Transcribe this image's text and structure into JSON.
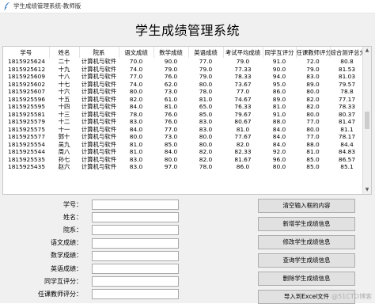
{
  "window": {
    "title": "学生成绩管理系统-教师版"
  },
  "heading": "学生成绩管理系统",
  "table": {
    "columns": [
      "学号",
      "姓名",
      "院系",
      "语文成绩",
      "数学成绩",
      "英语成绩",
      "考试平均成绩",
      "同学互评分",
      "任课教师评分",
      "综合测评总分"
    ],
    "rows": [
      [
        "1815925624",
        "二十",
        "计算机与软件",
        "70.0",
        "90.0",
        "77.0",
        "79.0",
        "91.0",
        "72.0",
        "80.8"
      ],
      [
        "1815925612",
        "十九",
        "计算机与软件",
        "74.0",
        "79.0",
        "79.0",
        "77.33",
        "90.0",
        "79.0",
        "81.53"
      ],
      [
        "1815925609",
        "十八",
        "计算机与软件",
        "77.0",
        "76.0",
        "79.0",
        "78.33",
        "94.0",
        "83.0",
        "81.03"
      ],
      [
        "1815925602",
        "十七",
        "计算机与软件",
        "74.0",
        "62.0",
        "80.0",
        "73.67",
        "95.0",
        "89.0",
        "79.57"
      ],
      [
        "1815925607",
        "十六",
        "计算机与软件",
        "80.0",
        "73.0",
        "78.0",
        "77.0",
        "86.0",
        "80.0",
        "78.8"
      ],
      [
        "1815925596",
        "十五",
        "计算机与软件",
        "82.0",
        "61.0",
        "81.0",
        "74.67",
        "89.0",
        "82.0",
        "77.17"
      ],
      [
        "1815925595",
        "十四",
        "计算机与软件",
        "84.0",
        "81.0",
        "65.0",
        "76.33",
        "81.0",
        "82.0",
        "78.33"
      ],
      [
        "1815925581",
        "十三",
        "计算机与软件",
        "78.0",
        "76.0",
        "85.0",
        "79.67",
        "91.0",
        "80.0",
        "80.37"
      ],
      [
        "1815925579",
        "十二",
        "计算机与软件",
        "83.0",
        "76.0",
        "83.0",
        "80.67",
        "88.0",
        "77.0",
        "81.47"
      ],
      [
        "1815925575",
        "十一",
        "计算机与软件",
        "84.0",
        "77.0",
        "83.0",
        "81.0",
        "84.0",
        "80.0",
        "81.1"
      ],
      [
        "1815925577",
        "郭十",
        "计算机与软件",
        "80.0",
        "73.0",
        "80.0",
        "77.67",
        "84.0",
        "77.0",
        "78.17"
      ],
      [
        "1815925554",
        "吴九",
        "计算机与软件",
        "81.0",
        "85.0",
        "80.0",
        "82.0",
        "84.0",
        "88.0",
        "84.4"
      ],
      [
        "1815925544",
        "周八",
        "计算机与软件",
        "81.0",
        "84.0",
        "82.0",
        "82.33",
        "92.0",
        "81.0",
        "84.83"
      ],
      [
        "1815925535",
        "孙七",
        "计算机与软件",
        "83.0",
        "80.0",
        "82.0",
        "81.67",
        "96.0",
        "85.0",
        "86.57"
      ],
      [
        "1815925435",
        "赵六",
        "计算机与软件",
        "83.0",
        "97.0",
        "78.0",
        "86.0",
        "80.0",
        "85.0",
        "85.1"
      ]
    ]
  },
  "form": {
    "fields": [
      {
        "label": "学号：",
        "value": ""
      },
      {
        "label": "姓名：",
        "value": ""
      },
      {
        "label": "院系：",
        "value": ""
      },
      {
        "label": "语文成绩：",
        "value": ""
      },
      {
        "label": "数学成绩：",
        "value": ""
      },
      {
        "label": "英语成绩：",
        "value": ""
      },
      {
        "label": "同学互评分：",
        "value": ""
      },
      {
        "label": "任课教师评分：",
        "value": ""
      }
    ]
  },
  "buttons": {
    "clear": "清空输入框的内容",
    "add": "新增学生成绩信息",
    "edit": "修改学生成绩信息",
    "query": "查询学生成绩信息",
    "delete": "删除学生成绩信息",
    "import": "导入到Excel文件"
  },
  "watermark": "@51CTO博客",
  "icons": {
    "app": "feather-icon",
    "scroll_up": "chevron-up-icon",
    "scroll_down": "chevron-down-icon"
  },
  "colors": {
    "window_bg": "#f0f0f0",
    "button_bg": "#e1e1e1",
    "table_bg": "#ffffff"
  }
}
